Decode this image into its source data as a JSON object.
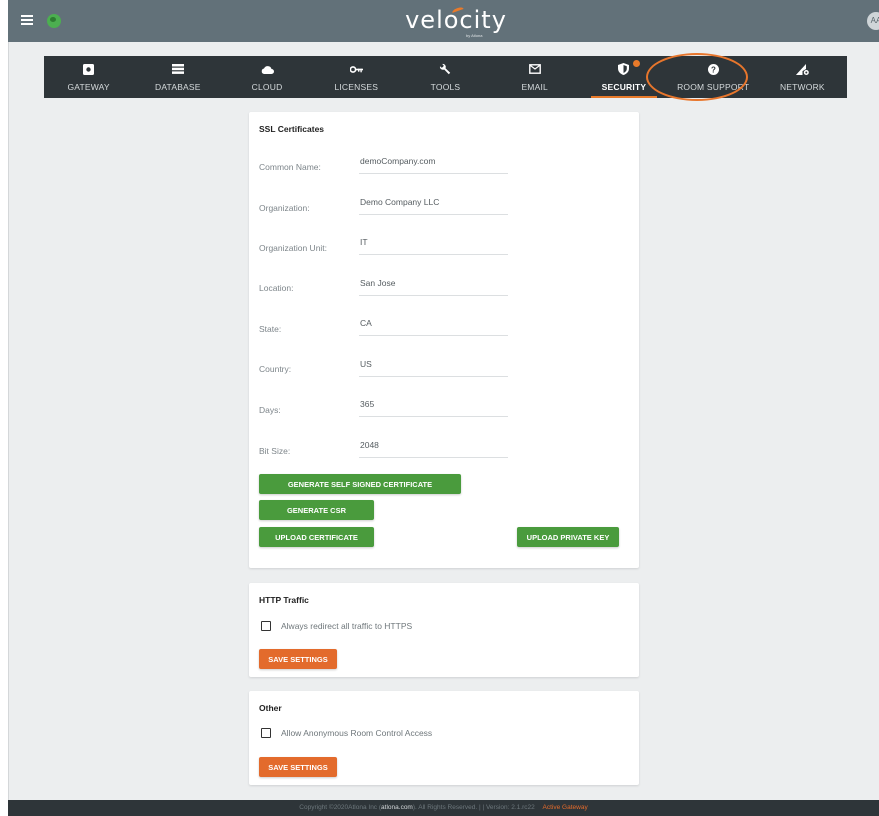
{
  "app": {
    "logo_text": "velocity",
    "logo_sub": "by Atlona",
    "avatar_initials": "AA"
  },
  "nav": {
    "items": [
      {
        "label": "GATEWAY",
        "icon": "gear-box-icon"
      },
      {
        "label": "DATABASE",
        "icon": "database-icon"
      },
      {
        "label": "CLOUD",
        "icon": "cloud-icon"
      },
      {
        "label": "LICENSES",
        "icon": "key-icon"
      },
      {
        "label": "TOOLS",
        "icon": "wrench-icon"
      },
      {
        "label": "EMAIL",
        "icon": "mail-icon"
      },
      {
        "label": "SECURITY",
        "icon": "shield-icon"
      },
      {
        "label": "ROOM SUPPORT",
        "icon": "help-icon"
      },
      {
        "label": "NETWORK",
        "icon": "signal-gear-icon"
      }
    ],
    "active": "SECURITY"
  },
  "ssl": {
    "title": "SSL Certificates",
    "fields": [
      {
        "label": "Common Name:",
        "value": "demoCompany.com"
      },
      {
        "label": "Organization:",
        "value": "Demo Company LLC"
      },
      {
        "label": "Organization Unit:",
        "value": "IT"
      },
      {
        "label": "Location:",
        "value": "San Jose"
      },
      {
        "label": "State:",
        "value": "CA"
      },
      {
        "label": "Country:",
        "value": "US"
      },
      {
        "label": "Days:",
        "value": "365"
      },
      {
        "label": "Bit Size:",
        "value": "2048"
      }
    ],
    "buttons": {
      "self_signed": "GENERATE SELF SIGNED CERTIFICATE",
      "csr": "GENERATE CSR",
      "upload_cert": "UPLOAD CERTIFICATE",
      "upload_key": "UPLOAD PRIVATE KEY"
    }
  },
  "http": {
    "title": "HTTP Traffic",
    "checkbox_label": "Always redirect all traffic to HTTPS",
    "save_label": "SAVE SETTINGS"
  },
  "other": {
    "title": "Other",
    "checkbox_label": "Allow Anonymous Room Control Access",
    "save_label": "SAVE SETTINGS"
  },
  "footer": {
    "prefix": "Copyright ©2020Atlona Inc (",
    "link": "atlona.com",
    "suffix": "). All Rights Reserved. | | Version: 2.1.rc22",
    "status": "Active Gateway"
  },
  "colors": {
    "accent_orange": "#e36b2c",
    "button_green": "#4a9b3d",
    "header_gray": "#627179",
    "nav_dark": "#2e3539"
  }
}
